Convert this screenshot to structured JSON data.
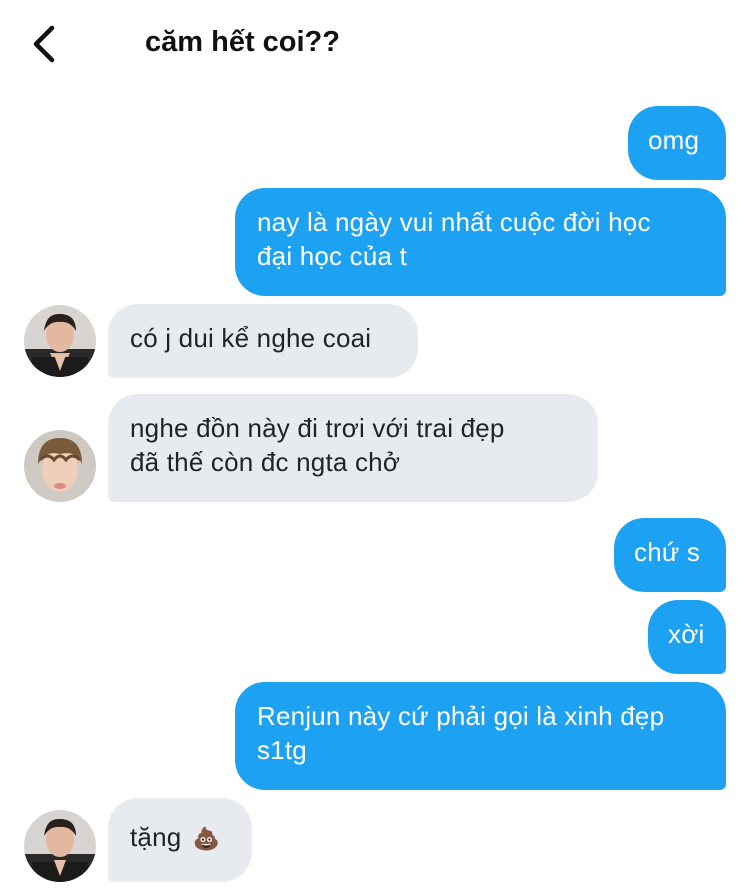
{
  "header": {
    "title": "căm hết coi??"
  },
  "messages": [
    {
      "side": "out",
      "text": "omg"
    },
    {
      "side": "out",
      "lines": [
        "nay là ngày vui nhất cuộc đời học",
        "đại học của t"
      ]
    },
    {
      "side": "in",
      "text": "có j dui kể nghe coai"
    },
    {
      "side": "in",
      "lines": [
        "nghe đồn này đi trơi với trai đẹp",
        "đã thế còn đc ngta chở"
      ]
    },
    {
      "side": "out",
      "text": "chứ s"
    },
    {
      "side": "out",
      "text": "xời"
    },
    {
      "side": "out",
      "lines": [
        "Renjun này cứ phải gọi là xinh đẹp",
        "s1tg"
      ]
    },
    {
      "side": "in",
      "text": "tặng",
      "emoji": "💩"
    }
  ],
  "icons": {
    "back": "chevron-left-icon",
    "emoji": "poop-emoji"
  },
  "colors": {
    "outgoing_bubble": "#1da1f2",
    "incoming_bubble": "#e7ebef",
    "outgoing_text": "#ffffff",
    "incoming_text": "#1f2328"
  }
}
